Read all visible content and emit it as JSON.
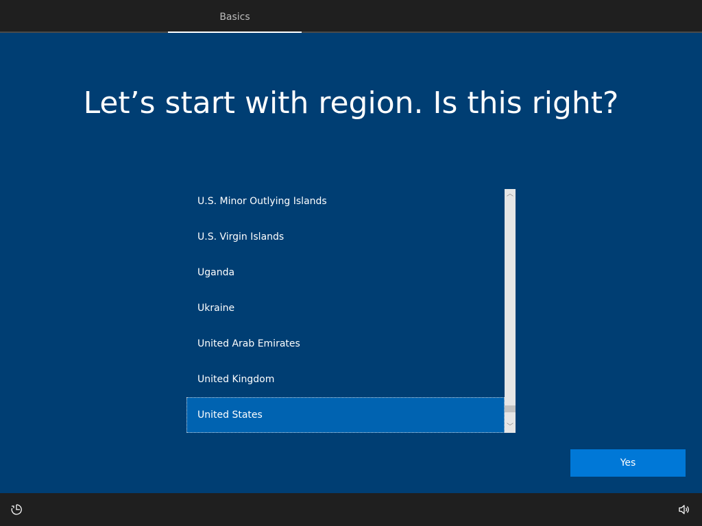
{
  "header": {
    "tabs": [
      {
        "label": "Basics",
        "active": true
      }
    ]
  },
  "main": {
    "title": "Let’s start with region. Is this right?",
    "region_list": {
      "items": [
        {
          "label": "U.S. Minor Outlying Islands",
          "selected": false
        },
        {
          "label": "U.S. Virgin Islands",
          "selected": false
        },
        {
          "label": "Uganda",
          "selected": false
        },
        {
          "label": "Ukraine",
          "selected": false
        },
        {
          "label": "United Arab Emirates",
          "selected": false
        },
        {
          "label": "United Kingdom",
          "selected": false
        },
        {
          "label": "United States",
          "selected": true
        }
      ],
      "scrollbar": {
        "up_glyph": "︿",
        "down_glyph": "﹀"
      }
    },
    "yes_button_label": "Yes"
  },
  "footer": {
    "icons": [
      "ease-of-access-icon",
      "volume-icon"
    ]
  },
  "colors": {
    "background": "#003e73",
    "bar": "#1f1f1f",
    "accent": "#0078d7",
    "selection": "#0063b1"
  }
}
